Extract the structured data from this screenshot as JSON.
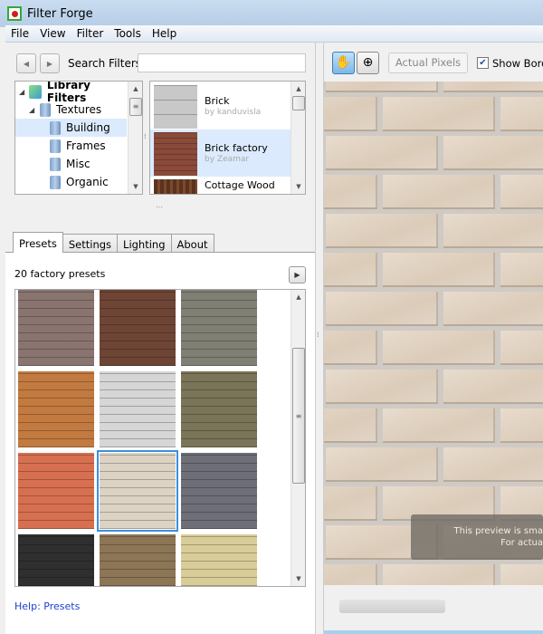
{
  "window": {
    "title": "Filter Forge"
  },
  "menu": [
    "File",
    "View",
    "Filter",
    "Tools",
    "Help"
  ],
  "search": {
    "label": "Search Filters:",
    "value": "",
    "placeholder": ""
  },
  "tree": [
    {
      "label": "Library Filters",
      "bold": true,
      "level": 0,
      "icon": "library-cube-icon"
    },
    {
      "label": "Textures",
      "level": 1,
      "icon": "folder-icon"
    },
    {
      "label": "Building",
      "level": 2,
      "icon": "folder-icon",
      "selected": true
    },
    {
      "label": "Frames",
      "level": 2,
      "icon": "folder-icon"
    },
    {
      "label": "Misc",
      "level": 2,
      "icon": "folder-icon"
    },
    {
      "label": "Organic",
      "level": 2,
      "icon": "folder-icon"
    }
  ],
  "filters": [
    {
      "name": "Brick",
      "author": "by kanduvisla",
      "color": "#c8c8c8"
    },
    {
      "name": "Brick factory",
      "author": "by Zeamar",
      "color": "#8a4a3a",
      "selected": true
    },
    {
      "name": "Cottage Wood",
      "author": "",
      "color": "#5a3220"
    }
  ],
  "tabs": [
    "Presets",
    "Settings",
    "Lighting",
    "About"
  ],
  "presets": {
    "count_label": "20 factory presets",
    "colors": [
      "#8a7470",
      "#6e4535",
      "#7f7f74",
      "#c27a40",
      "#d6d6d6",
      "#7a7458",
      "#d77050",
      "#ddd3c5",
      "#6e6e78",
      "#2f2f2f",
      "#8c7656",
      "#d8cc98"
    ],
    "selected_index": 7
  },
  "help_link": "Help: Presets",
  "toolbar": {
    "actual_pixels": "Actual Pixels",
    "show_border": "Show Bord",
    "show_border_checked": true
  },
  "preview": {
    "notice_line1": "This preview is sma",
    "notice_line2": "For actua"
  },
  "colors": {
    "accent": "#3b8fe0",
    "selection": "#dbeafc",
    "link": "#1c3fd0"
  }
}
